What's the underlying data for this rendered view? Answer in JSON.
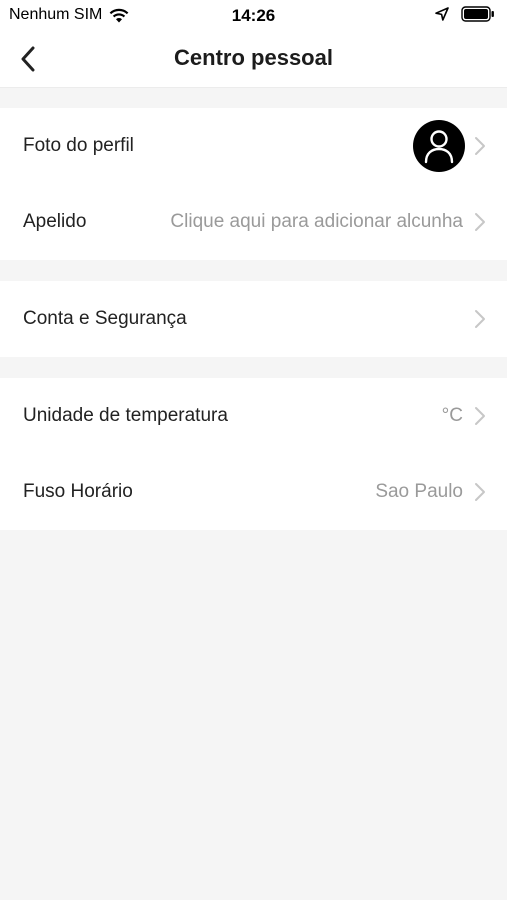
{
  "status_bar": {
    "carrier": "Nenhum SIM",
    "time": "14:26"
  },
  "header": {
    "title": "Centro pessoal"
  },
  "groups": [
    {
      "rows": [
        {
          "label": "Foto do perfil",
          "value": ""
        },
        {
          "label": "Apelido",
          "value": "Clique aqui para adicionar alcunha"
        }
      ]
    },
    {
      "rows": [
        {
          "label": "Conta e Segurança",
          "value": ""
        }
      ]
    },
    {
      "rows": [
        {
          "label": "Unidade de temperatura",
          "value": "°C"
        },
        {
          "label": "Fuso Horário",
          "value": "Sao Paulo"
        }
      ]
    }
  ],
  "icons": {
    "status": [
      "wifi-icon",
      "location-arrow-icon",
      "battery-icon"
    ],
    "navigation": [
      "back-chevron-icon"
    ],
    "rows": [
      "avatar-person-icon",
      "chevron-right-icon"
    ]
  },
  "colors": {
    "background": "#f5f5f5",
    "surface": "#ffffff",
    "text": "#222222",
    "secondary_text": "#9a9a9a",
    "chevron": "#c7c7c7"
  }
}
